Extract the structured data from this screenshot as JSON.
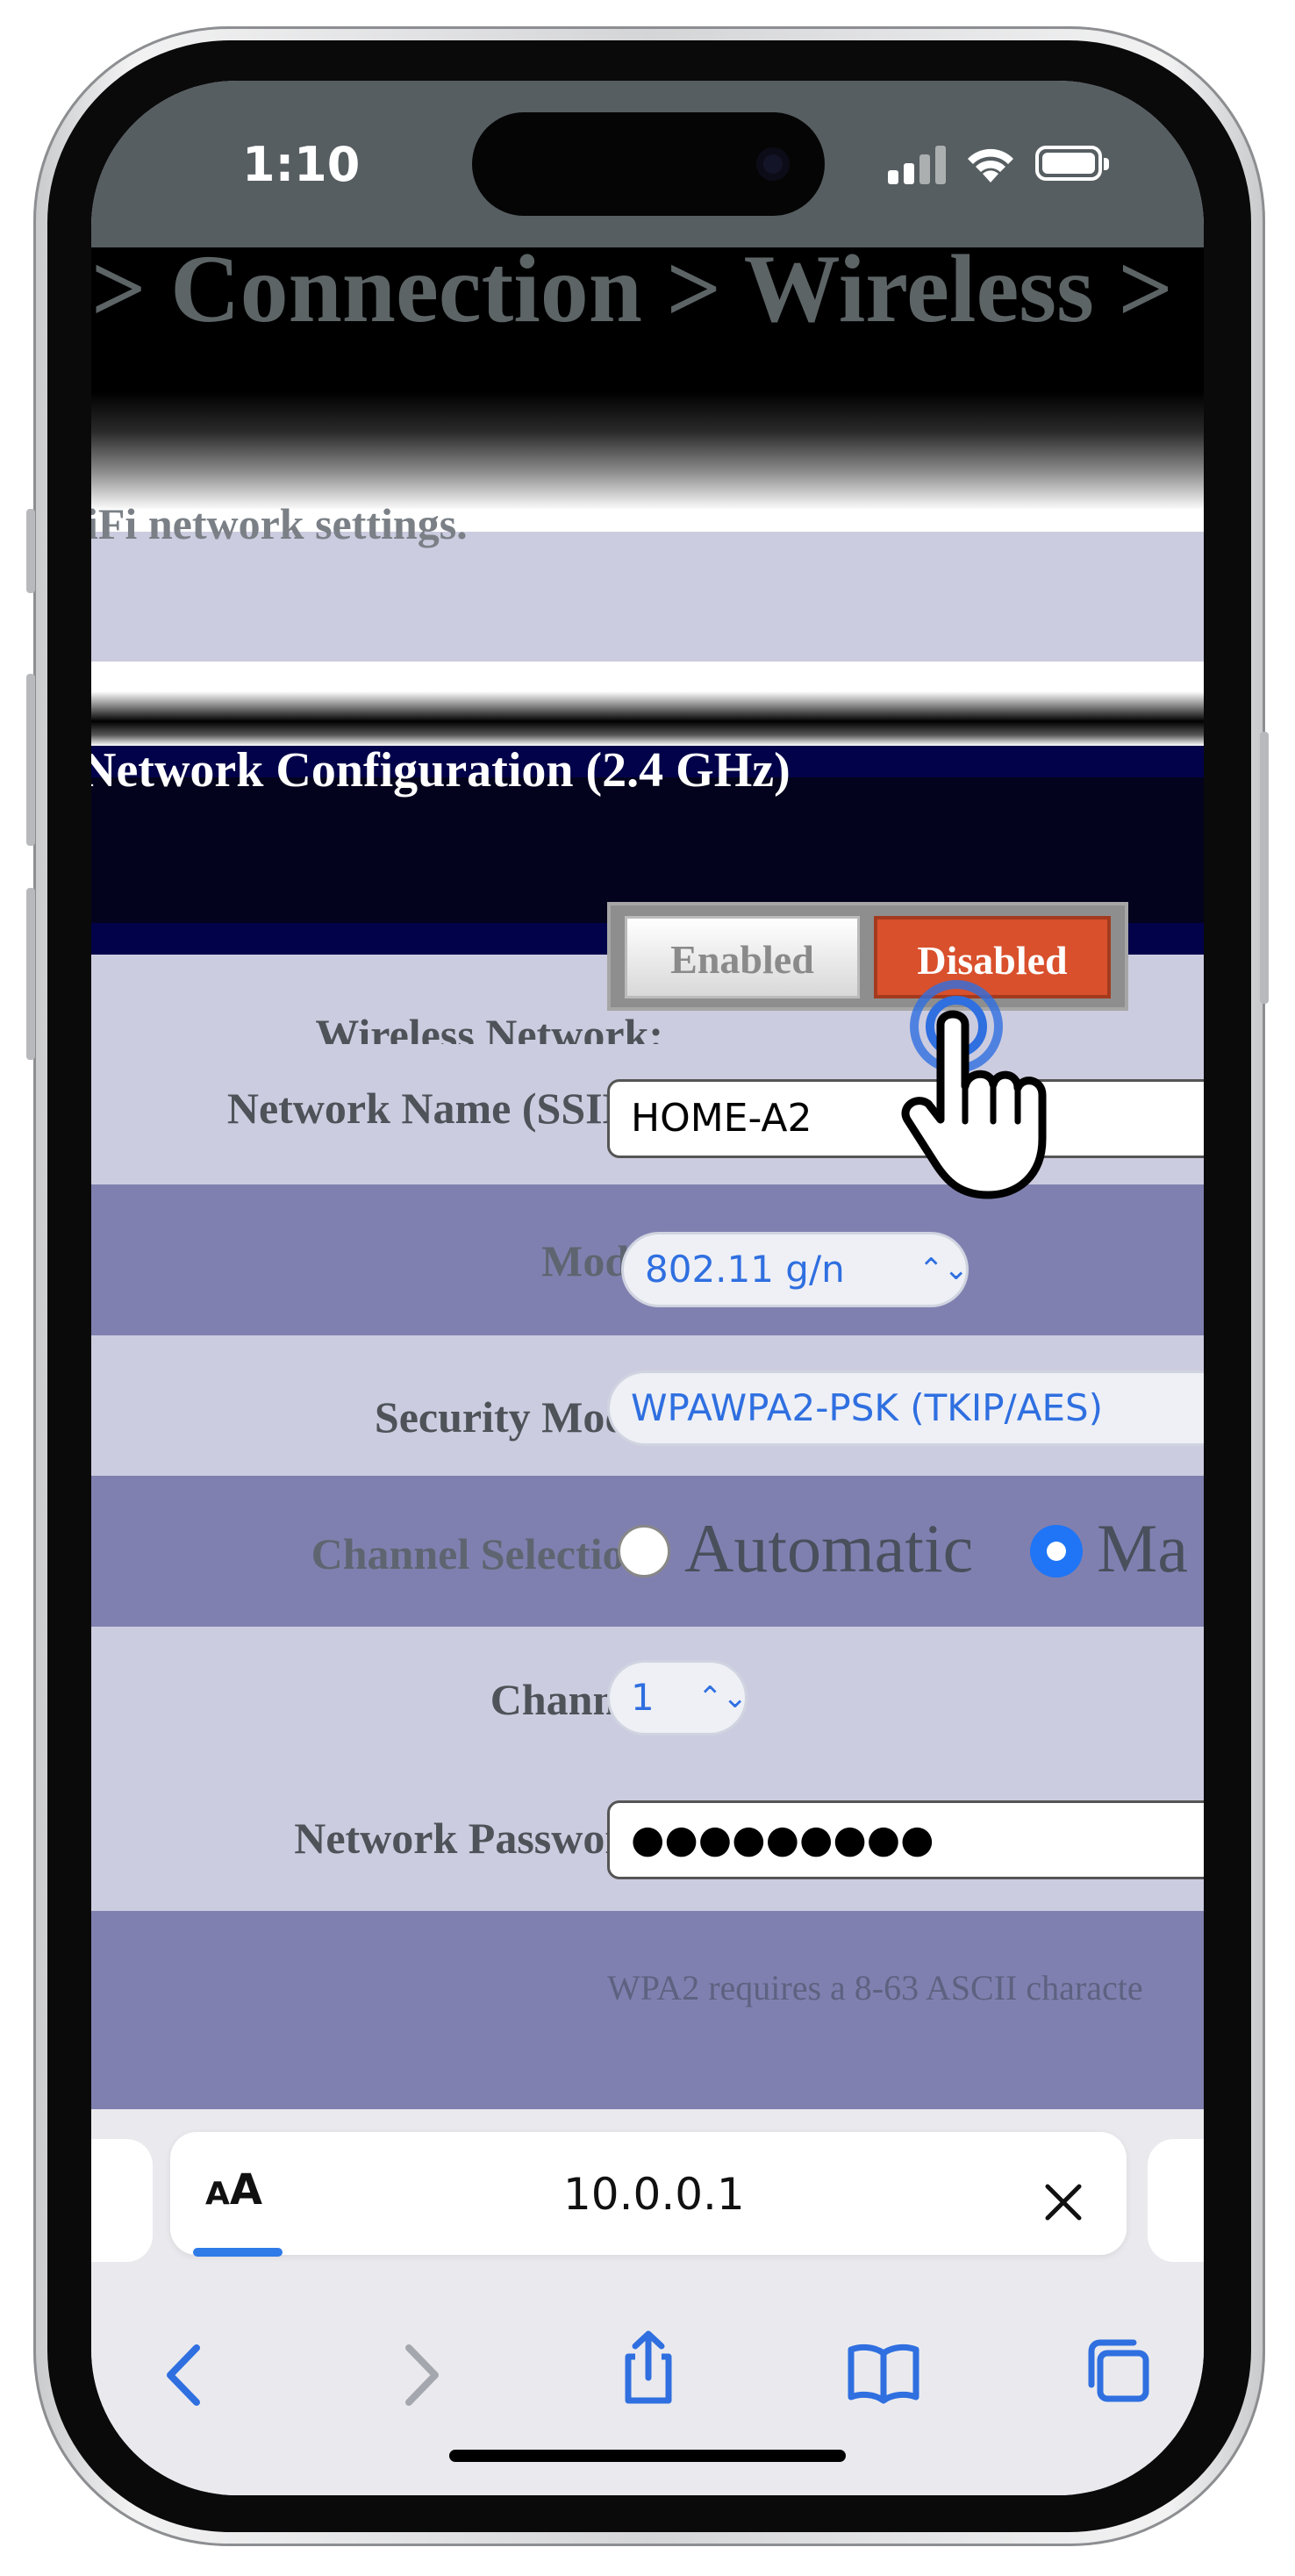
{
  "status_bar": {
    "time": "1:10"
  },
  "page": {
    "breadcrumb": "> Connection > Wireless >",
    "description": "iFi network settings.",
    "section_title": "Network Configuration (2.4 GHz)"
  },
  "form": {
    "wireless_network": {
      "label": "Wireless Network:",
      "enabled_label": "Enabled",
      "disabled_label": "Disabled",
      "selected": "Disabled"
    },
    "ssid": {
      "label": "Network Name (SSID):",
      "value": "HOME-A2"
    },
    "mode": {
      "label": "Mode:",
      "value": "802.11 g/n"
    },
    "security_mode": {
      "label": "Security Mode:",
      "value": "WPAWPA2-PSK (TKIP/AES)"
    },
    "channel_selection": {
      "label": "Channel Selection:",
      "automatic_label": "Automatic",
      "manual_label": "Ma",
      "selected": "manual"
    },
    "channel": {
      "label": "Channel:",
      "value": "1"
    },
    "password": {
      "label": "Network Password:",
      "value": "●●●●●●●●●"
    },
    "hint": "WPA2 requires a 8-63 ASCII characte"
  },
  "browser": {
    "aa_small": "A",
    "aa_big": "A",
    "url": "10.0.0.1",
    "toolbar_icons": [
      "back-icon",
      "forward-icon",
      "share-icon",
      "bookmarks-icon",
      "tabs-icon"
    ]
  },
  "colors": {
    "accent": "#2f6fe0",
    "disabled_button": "#d9502c",
    "row_light": "#cccce0",
    "row_dark": "#8080b0",
    "header_navy": "#03031e"
  }
}
